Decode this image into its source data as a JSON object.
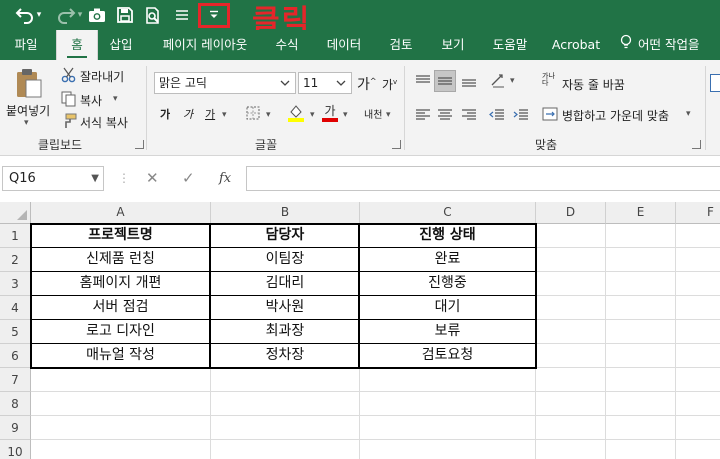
{
  "quick_access": {
    "undo_icon": "undo-icon",
    "redo_icon": "redo-icon",
    "camera_icon": "camera-icon",
    "save_icon": "save-icon",
    "print_preview_icon": "print-preview-icon",
    "list_icon": "list-icon",
    "customize_icon": "chevron-down-icon",
    "annotation": "클릭",
    "annotation_color": "#e5262a"
  },
  "tabs": [
    "파일",
    "홈",
    "삽입",
    "페이지 레이아웃",
    "수식",
    "데이터",
    "검토",
    "보기",
    "도움말",
    "Acrobat",
    "어떤 작업을"
  ],
  "active_tab": "홈",
  "ribbon": {
    "clipboard": {
      "paste": "붙여넣기",
      "cut": "잘라내기",
      "copy": "복사",
      "format_painter": "서식 복사",
      "label": "클립보드"
    },
    "font": {
      "font_name": "맑은 고딕",
      "font_size": "11",
      "grow": "가",
      "shrink": "가",
      "bold": "가",
      "italic": "가",
      "underline": "가",
      "font_color_letter": "가",
      "phonetic": "내천",
      "label": "글꼴",
      "highlight_color": "#ffff00",
      "font_color": "#e00000"
    },
    "alignment": {
      "wrap_text": "자동 줄 바꿈",
      "merge_center": "병합하고 가운데 맞춤",
      "wrap_icon_text": "가나다",
      "label": "맞춤"
    }
  },
  "formula_bar": {
    "name_box": "Q16",
    "cancel": "✕",
    "enter": "✓",
    "fx": "fx",
    "value": ""
  },
  "sheet": {
    "columns": [
      "A",
      "B",
      "C",
      "D",
      "E",
      "F"
    ],
    "rows": [
      "1",
      "2",
      "3",
      "4",
      "5",
      "6",
      "7",
      "8",
      "9",
      "10"
    ],
    "header": [
      "프로젝트명",
      "담당자",
      "진행 상태"
    ],
    "data": [
      [
        "신제품 런칭",
        "이팀장",
        "완료"
      ],
      [
        "홈페이지 개편",
        "김대리",
        "진행중"
      ],
      [
        "서버 점검",
        "박사원",
        "대기"
      ],
      [
        "로고 디자인",
        "최과장",
        "보류"
      ],
      [
        "매뉴얼 작성",
        "정차장",
        "검토요청"
      ]
    ]
  },
  "colors": {
    "title_bar": "#217346",
    "ribbon_bg": "#f3f3f3"
  }
}
